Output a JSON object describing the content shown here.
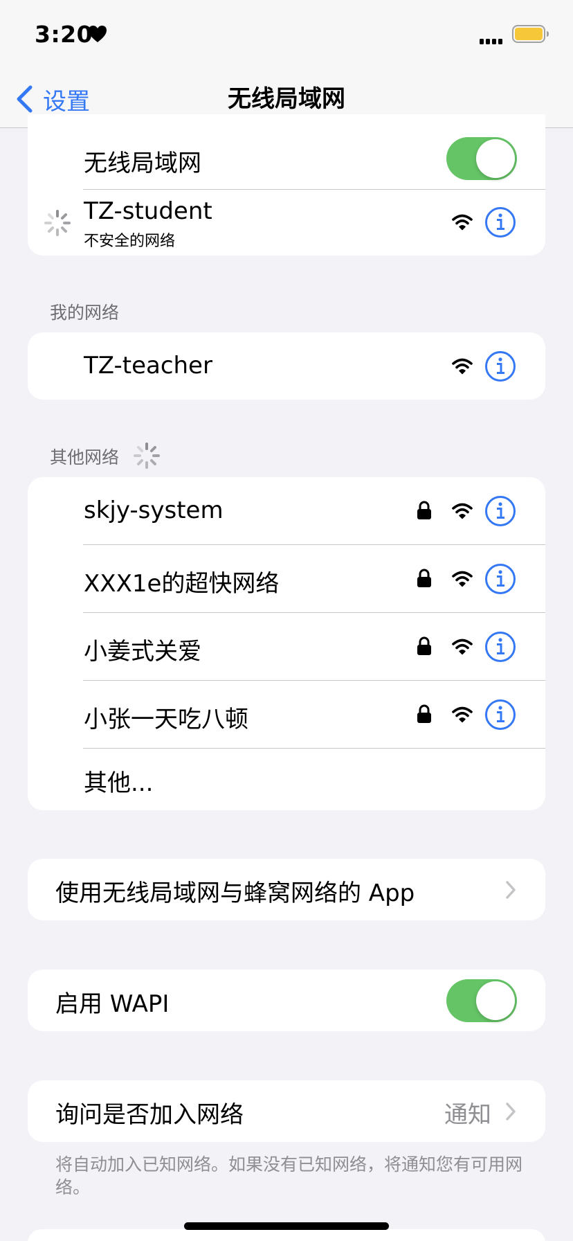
{
  "status_bar": {
    "time": "3:20",
    "status_icon": "heart-icon",
    "signal_icon": "cellular-signal-icon",
    "battery_icon": "battery-icon",
    "battery_color": "#f5c739"
  },
  "nav": {
    "back_label": "设置",
    "title": "无线局域网"
  },
  "wifi_toggle": {
    "label": "无线局域网",
    "on": true
  },
  "current_network": {
    "name": "TZ-student",
    "subtitle": "不安全的网络",
    "status": "connecting"
  },
  "my_networks": {
    "header": "我的网络",
    "items": [
      {
        "name": "TZ-teacher",
        "locked": false
      }
    ]
  },
  "other_networks": {
    "header": "其他网络",
    "items": [
      {
        "name": "skjy-system",
        "locked": true
      },
      {
        "name": "XXX1e的超快网络",
        "locked": true
      },
      {
        "name": "小姜式关爱",
        "locked": true
      },
      {
        "name": "小张一天吃八顿",
        "locked": true
      }
    ],
    "other_label": "其他..."
  },
  "apps_row": {
    "label": "使用无线局域网与蜂窝网络的 App"
  },
  "wapi": {
    "label": "启用 WAPI",
    "on": true
  },
  "ask_to_join": {
    "label": "询问是否加入网络",
    "value": "通知",
    "footer": "将自动加入已知网络。如果没有已知网络，将通知您有可用网络。"
  },
  "colors": {
    "accent": "#3478f6",
    "toggle_on": "#65c466",
    "background": "#f2f2f7",
    "secondary_text": "#6d6d72",
    "tertiary_text": "#8e8e93"
  }
}
